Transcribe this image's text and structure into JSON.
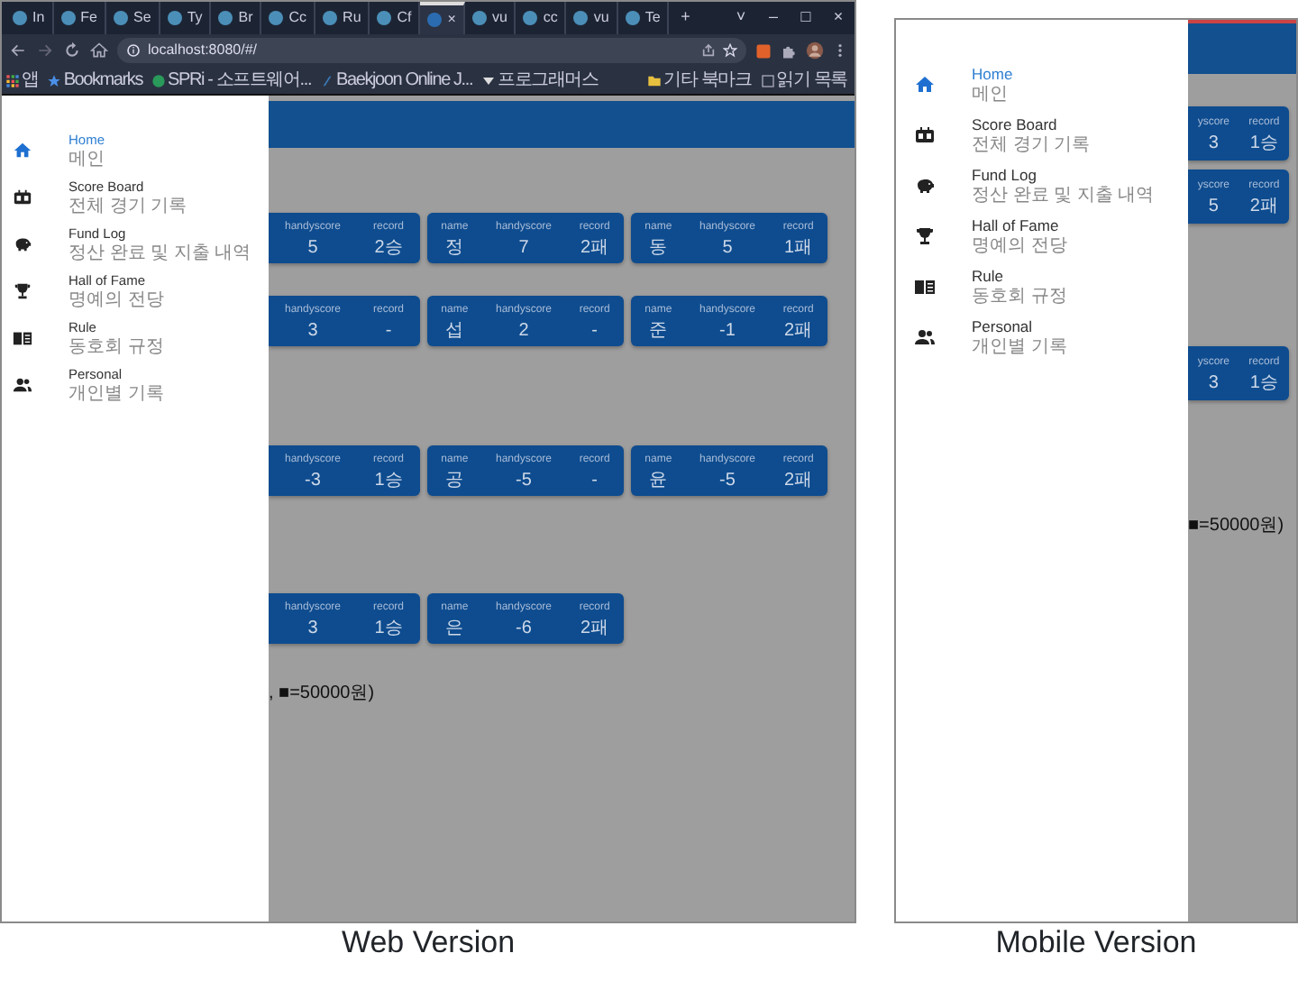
{
  "web": {
    "browser": {
      "tabs": [
        {
          "label": "In",
          "selected": false
        },
        {
          "label": "Fe",
          "selected": false
        },
        {
          "label": "Se",
          "selected": false
        },
        {
          "label": "Ty",
          "selected": false
        },
        {
          "label": "Br",
          "selected": false
        },
        {
          "label": "Cc",
          "selected": false
        },
        {
          "label": "Ru",
          "selected": false
        },
        {
          "label": "Cf",
          "selected": false
        },
        {
          "label": "×",
          "selected": true
        },
        {
          "label": "vu",
          "selected": false
        },
        {
          "label": "cc",
          "selected": false
        },
        {
          "label": "vu",
          "selected": false
        },
        {
          "label": "Te",
          "selected": false
        }
      ],
      "new_tab": "+",
      "window_controls": [
        "˅",
        "–",
        "□",
        "×"
      ],
      "address": "localhost:8080/#/",
      "bookmarks": [
        "앱",
        "Bookmarks",
        "SPRi - 소프트웨어...",
        "Baekjoon Online J...",
        "프로그래머스"
      ],
      "other_bookmarks": "기타 북마크",
      "reading_list": "읽기 목록"
    },
    "drawer": [
      {
        "title": "Home",
        "subtitle": "메인",
        "selected": true
      },
      {
        "title": "Score Board",
        "subtitle": "전체 경기 기록",
        "selected": false
      },
      {
        "title": "Fund Log",
        "subtitle": "정산 완료 및 지출 내역",
        "selected": false
      },
      {
        "title": "Hall of Fame",
        "subtitle": "명예의 전당",
        "selected": false
      },
      {
        "title": "Rule",
        "subtitle": "동호회 규정",
        "selected": false
      },
      {
        "title": "Personal",
        "subtitle": "개인별 기록",
        "selected": false
      }
    ],
    "card_rows": [
      [
        {
          "cells": [
            {
              "header": "handyscore",
              "value": "5"
            },
            {
              "header": "record",
              "value": "2승"
            }
          ]
        },
        {
          "cells": [
            {
              "header": "name",
              "value": "정"
            },
            {
              "header": "handyscore",
              "value": "7"
            },
            {
              "header": "record",
              "value": "2패"
            }
          ]
        },
        {
          "cells": [
            {
              "header": "name",
              "value": "동"
            },
            {
              "header": "handyscore",
              "value": "5"
            },
            {
              "header": "record",
              "value": "1패"
            }
          ]
        }
      ],
      [
        {
          "cells": [
            {
              "header": "handyscore",
              "value": "3"
            },
            {
              "header": "record",
              "value": "-"
            }
          ]
        },
        {
          "cells": [
            {
              "header": "name",
              "value": "섭"
            },
            {
              "header": "handyscore",
              "value": "2"
            },
            {
              "header": "record",
              "value": "-"
            }
          ]
        },
        {
          "cells": [
            {
              "header": "name",
              "value": "준"
            },
            {
              "header": "handyscore",
              "value": "-1"
            },
            {
              "header": "record",
              "value": "2패"
            }
          ]
        }
      ],
      [
        {
          "cells": [
            {
              "header": "handyscore",
              "value": "-3"
            },
            {
              "header": "record",
              "value": "1승"
            }
          ]
        },
        {
          "cells": [
            {
              "header": "name",
              "value": "공"
            },
            {
              "header": "handyscore",
              "value": "-5"
            },
            {
              "header": "record",
              "value": "-"
            }
          ]
        },
        {
          "cells": [
            {
              "header": "name",
              "value": "윤"
            },
            {
              "header": "handyscore",
              "value": "-5"
            },
            {
              "header": "record",
              "value": "2패"
            }
          ]
        }
      ],
      [
        {
          "cells": [
            {
              "header": "handyscore",
              "value": "3"
            },
            {
              "header": "record",
              "value": "1승"
            }
          ]
        },
        {
          "cells": [
            {
              "header": "name",
              "value": "은"
            },
            {
              "header": "handyscore",
              "value": "-6"
            },
            {
              "header": "record",
              "value": "2패"
            }
          ]
        }
      ]
    ],
    "footnote": ", ■=50000원)",
    "caption": "Web Version"
  },
  "mobile": {
    "drawer": [
      {
        "title": "Home",
        "subtitle": "메인",
        "selected": true
      },
      {
        "title": "Score Board",
        "subtitle": "전체 경기 기록",
        "selected": false
      },
      {
        "title": "Fund Log",
        "subtitle": "정산 완료 및 지출 내역",
        "selected": false
      },
      {
        "title": "Hall of Fame",
        "subtitle": "명예의 전당",
        "selected": false
      },
      {
        "title": "Rule",
        "subtitle": "동호회 규정",
        "selected": false
      },
      {
        "title": "Personal",
        "subtitle": "개인별 기록",
        "selected": false
      }
    ],
    "card_rows": [
      [
        {
          "cells": [
            {
              "header": "yscore",
              "value": "3"
            },
            {
              "header": "record",
              "value": "1승"
            }
          ]
        }
      ],
      [
        {
          "cells": [
            {
              "header": "yscore",
              "value": "5"
            },
            {
              "header": "record",
              "value": "2패"
            }
          ]
        }
      ],
      [
        {
          "cells": [
            {
              "header": "yscore",
              "value": "3"
            },
            {
              "header": "record",
              "value": "1승"
            }
          ]
        }
      ]
    ],
    "footnote": "■=50000원)",
    "caption": "Mobile Version"
  }
}
